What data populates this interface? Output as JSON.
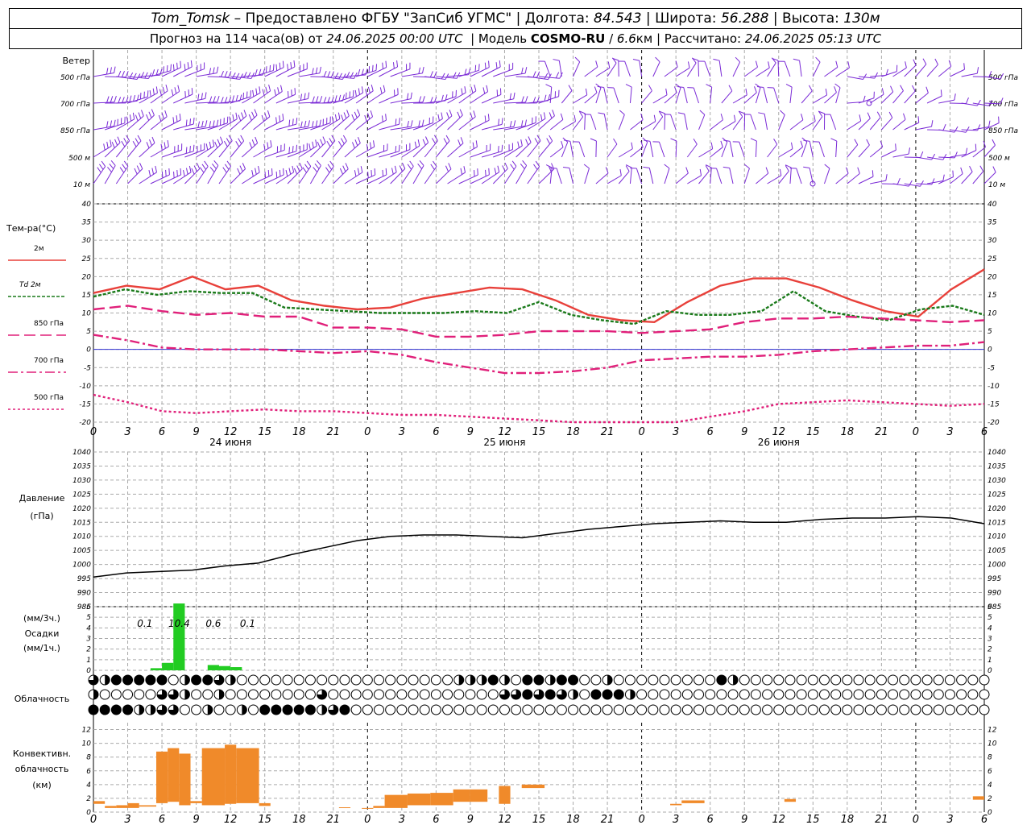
{
  "header": {
    "station": "Tom_Tomsk",
    "provider": " – Предоставлено ФГБУ \"ЗапСиб УГМС\" | Долгота: ",
    "lon": "84.543",
    "lat_label": " | Широта: ",
    "lat": "56.288",
    "alt_label": " | Высота: ",
    "alt": "130м",
    "forecast_prefix": "Прогноз на 114 часа(ов) от ",
    "forecast_date": "24.06.2025 00:00 UTC",
    "model_label": "  | Модель ",
    "model_name": "COSMO-RU",
    "model_res_prefix": " / ",
    "model_res": "6.6",
    "model_res_unit": "км",
    "calc_label": " | Рассчитано: ",
    "calc_date": "24.06.2025 05:13 UTC"
  },
  "chart_data": [
    {
      "type": "line",
      "id": "wind",
      "title": "Ветер",
      "levels": [
        "500 гПа",
        "700 гПа",
        "850 гПа",
        "500 м",
        "10 м"
      ],
      "colors": {
        "barbs": "#7a2ad6"
      }
    },
    {
      "type": "line",
      "id": "temperature",
      "ylabel": "Тем-ра(°C)",
      "ylim": [
        -20,
        40
      ],
      "yticks": [
        -20,
        -15,
        -10,
        -5,
        0,
        5,
        10,
        15,
        20,
        25,
        30,
        35,
        40
      ],
      "x_hours": [
        0,
        3,
        6,
        9,
        12,
        15,
        18,
        21,
        24,
        27,
        30,
        33,
        36,
        39,
        42,
        45,
        48,
        51,
        54,
        57,
        60,
        63,
        66,
        69,
        72,
        75,
        78
      ],
      "series": [
        {
          "name": "2м",
          "color": "#e8403a",
          "dash": "",
          "values": [
            15.5,
            17.5,
            16.5,
            20,
            16.5,
            17.5,
            13.5,
            12,
            11,
            11.5,
            14,
            15.5,
            17,
            16.5,
            13.5,
            9.5,
            8,
            7.5,
            13,
            17.5,
            19.5,
            19.5,
            17,
            13.5,
            10.5,
            9,
            16.5,
            22
          ]
        },
        {
          "name": "Td 2м",
          "color": "#1a7a1a",
          "dash": "4,2",
          "values": [
            14.5,
            16.5,
            15,
            16,
            15.5,
            15.5,
            11.5,
            11,
            10.5,
            10,
            10,
            10,
            10.5,
            10,
            13,
            9.5,
            8,
            7,
            10.5,
            9.5,
            9.5,
            10.5,
            16,
            10.5,
            9,
            8,
            11,
            12,
            9.5
          ]
        },
        {
          "name": "850 гПа",
          "color": "#e0207a",
          "dash": "14,6",
          "values": [
            11,
            12,
            10.5,
            9.5,
            10,
            9,
            9,
            6,
            6,
            5.5,
            3.5,
            3.5,
            4,
            5,
            5,
            5,
            4.5,
            5,
            5.5,
            7.5,
            8.5,
            8.5,
            9,
            8.5,
            8,
            7.5,
            8
          ]
        },
        {
          "name": "700 гПа",
          "color": "#e0207a",
          "dash": "12,4,3,4",
          "values": [
            4,
            2.5,
            0.5,
            0,
            0,
            0,
            -0.5,
            -1,
            -0.5,
            -1.5,
            -3.5,
            -5,
            -6.5,
            -6.5,
            -6,
            -5,
            -3,
            -2.5,
            -2,
            -2,
            -1.5,
            -0.5,
            0,
            0.5,
            1,
            1,
            2
          ]
        },
        {
          "name": "500 гПа",
          "color": "#e0207a",
          "dash": "3,3",
          "values": [
            -12.5,
            -14.5,
            -17,
            -17.5,
            -17,
            -16.5,
            -17,
            -17,
            -17.5,
            -18,
            -18,
            -18.5,
            -19,
            -19.5,
            -20,
            -20.5,
            -21,
            -20,
            -18.5,
            -17,
            -15,
            -14.5,
            -14,
            -14.5,
            -15,
            -15.5,
            -15
          ]
        }
      ],
      "zero_line_color": "#3030d0"
    },
    {
      "type": "line",
      "id": "pressure",
      "ylabel": "Давление",
      "yunit": "(гПа)",
      "ylim": [
        985,
        1040
      ],
      "yticks": [
        985,
        990,
        995,
        1000,
        1005,
        1010,
        1015,
        1020,
        1025,
        1030,
        1035,
        1040
      ],
      "values": [
        995.5,
        997,
        997.5,
        998,
        999.5,
        1000.5,
        1003.5,
        1006,
        1008.5,
        1010,
        1010.5,
        1010.5,
        1010,
        1009.5,
        1011,
        1012.5,
        1013.5,
        1014.5,
        1015,
        1015.5,
        1015,
        1015,
        1016,
        1016.5,
        1016.5,
        1017,
        1016.5,
        1014.5
      ],
      "color": "#000000"
    },
    {
      "type": "bar",
      "id": "precip",
      "ylabel": "Осадки",
      "unit_top": "(мм/3ч.)",
      "unit_bottom": "(мм/1ч.)",
      "ylim": [
        0,
        6
      ],
      "yticks": [
        0,
        1,
        2,
        3,
        4,
        5,
        6
      ],
      "sum_labels": [
        {
          "hour": 4.5,
          "text": "0.1"
        },
        {
          "hour": 7.5,
          "text": "10.4"
        },
        {
          "hour": 10.5,
          "text": "0.6"
        },
        {
          "hour": 13.5,
          "text": "0.1"
        }
      ],
      "bars_hourly": [
        {
          "h": 5,
          "v": 0.2
        },
        {
          "h": 6,
          "v": 0.7
        },
        {
          "h": 7,
          "v": 6.3
        },
        {
          "h": 10,
          "v": 0.5
        },
        {
          "h": 11,
          "v": 0.4
        },
        {
          "h": 12,
          "v": 0.3
        }
      ],
      "color": "#22cc22"
    },
    {
      "type": "table",
      "id": "clouds",
      "ylabel": "Облачность",
      "rows": [
        [
          0.75,
          0.5,
          1,
          1,
          1,
          1,
          1,
          0,
          0.5,
          1,
          1,
          0.75,
          0.5,
          0,
          0,
          0,
          0,
          0,
          0,
          0,
          0,
          0,
          0,
          0,
          0,
          0,
          0,
          0,
          0,
          0,
          0,
          0,
          0.5,
          0.5,
          0.5,
          1,
          0.5,
          0,
          1,
          1,
          0.5,
          1,
          1,
          0,
          0,
          0.5,
          0,
          0,
          0,
          0,
          0,
          0,
          0,
          0,
          0,
          1,
          0.5,
          0,
          0,
          0,
          0,
          0,
          0,
          0,
          0,
          0,
          0,
          0,
          0,
          0,
          0,
          0,
          0,
          0,
          0,
          0,
          0,
          0,
          0,
          0,
          0,
          0,
          0,
          0,
          0,
          0,
          0,
          0
        ],
        [
          0.5,
          0,
          0,
          0,
          0,
          0,
          0.75,
          0.75,
          0.5,
          0,
          0,
          0.5,
          0,
          0,
          0,
          0,
          0,
          0,
          0,
          0,
          0.75,
          0,
          0,
          0,
          0,
          0,
          0,
          0,
          0,
          0,
          0,
          0,
          0,
          0,
          0,
          0,
          0.75,
          0.75,
          1,
          0.75,
          1,
          0.75,
          0.5,
          0,
          1,
          1,
          1,
          0.5,
          0,
          0,
          0,
          0,
          0,
          0,
          0,
          0,
          0,
          0,
          0,
          0,
          0,
          0,
          0,
          0,
          0,
          0,
          0,
          0,
          0,
          0,
          0,
          0,
          0,
          0,
          0,
          0,
          0,
          0,
          0,
          0,
          0,
          0,
          0,
          0,
          0,
          0,
          0,
          0
        ],
        [
          1,
          1,
          1,
          1,
          0.5,
          0.5,
          0.75,
          0.75,
          0,
          0,
          0.5,
          0,
          0,
          0.5,
          0,
          1,
          1,
          1,
          1,
          1,
          0.5,
          0.75,
          1,
          0,
          0,
          0,
          0,
          0,
          0,
          0,
          0,
          0,
          0,
          0,
          0,
          0,
          0,
          0,
          0,
          0,
          0,
          0,
          0,
          0,
          0,
          0,
          0,
          0,
          0,
          0,
          0,
          0,
          0,
          0,
          0,
          0,
          0,
          0,
          0,
          0,
          0,
          0,
          0,
          0,
          0,
          0,
          0,
          0,
          0,
          0,
          0,
          0,
          0,
          0,
          0,
          0,
          0,
          0,
          0,
          0,
          0,
          0,
          0,
          0,
          0,
          0,
          0,
          0
        ]
      ]
    },
    {
      "type": "bar",
      "id": "convective",
      "ylabel": "Конвективн.",
      "ylabel2": "облачность",
      "yunit": "(км)",
      "ylim": [
        0,
        13
      ],
      "yticks": [
        0,
        2,
        4,
        6,
        8,
        10,
        12
      ],
      "bars": [
        {
          "h0": 0,
          "h1": 1,
          "base": 1.2,
          "top": 1.6
        },
        {
          "h0": 1,
          "h1": 2,
          "base": 0.6,
          "top": 0.9
        },
        {
          "h0": 2,
          "h1": 3,
          "base": 0.6,
          "top": 1.0
        },
        {
          "h0": 3,
          "h1": 4,
          "base": 0.6,
          "top": 1.3
        },
        {
          "h0": 4,
          "h1": 5.5,
          "base": 0.8,
          "top": 1.0
        },
        {
          "h0": 5.5,
          "h1": 6.5,
          "base": 1.3,
          "top": 8.8
        },
        {
          "h0": 6.5,
          "h1": 7.5,
          "base": 1.5,
          "top": 9.3
        },
        {
          "h0": 7.5,
          "h1": 8.5,
          "base": 1.0,
          "top": 8.5
        },
        {
          "h0": 8.5,
          "h1": 9.5,
          "base": 1.3,
          "top": 1.6
        },
        {
          "h0": 9.5,
          "h1": 11.5,
          "base": 1.0,
          "top": 9.3
        },
        {
          "h0": 11.5,
          "h1": 12.5,
          "base": 1.2,
          "top": 9.8
        },
        {
          "h0": 12.5,
          "h1": 14.5,
          "base": 1.3,
          "top": 9.3
        },
        {
          "h0": 14.5,
          "h1": 15.5,
          "base": 0.9,
          "top": 1.3
        },
        {
          "h0": 21.5,
          "h1": 22.5,
          "base": 0.6,
          "top": 0.7
        },
        {
          "h0": 23.5,
          "h1": 24.5,
          "base": 0.5,
          "top": 0.6
        },
        {
          "h0": 24.5,
          "h1": 25.5,
          "base": 0.6,
          "top": 0.9
        },
        {
          "h0": 25.5,
          "h1": 27.5,
          "base": 0.6,
          "top": 2.5
        },
        {
          "h0": 27.5,
          "h1": 29.5,
          "base": 1.0,
          "top": 2.7
        },
        {
          "h0": 29.5,
          "h1": 31.5,
          "base": 1.0,
          "top": 2.8
        },
        {
          "h0": 31.5,
          "h1": 33,
          "base": 1.5,
          "top": 3.3
        },
        {
          "h0": 33,
          "h1": 34.5,
          "base": 1.5,
          "top": 3.3
        },
        {
          "h0": 35.5,
          "h1": 36.5,
          "base": 1.2,
          "top": 3.8
        },
        {
          "h0": 37.5,
          "h1": 39.5,
          "base": 3.5,
          "top": 4.0
        },
        {
          "h0": 50.5,
          "h1": 51.5,
          "base": 1.0,
          "top": 1.2
        },
        {
          "h0": 51.5,
          "h1": 53.5,
          "base": 1.3,
          "top": 1.7
        },
        {
          "h0": 60.5,
          "h1": 61.5,
          "base": 1.5,
          "top": 1.9
        },
        {
          "h0": 77,
          "h1": 78,
          "base": 1.8,
          "top": 2.3
        }
      ],
      "color": "#f08a2a"
    }
  ],
  "time_axis": {
    "hour_labels": [
      "0",
      "3",
      "6",
      "9",
      "12",
      "15",
      "18",
      "21",
      "0",
      "3",
      "6",
      "9",
      "12",
      "15",
      "18",
      "21",
      "0",
      "3",
      "6",
      "9",
      "12",
      "15",
      "18",
      "21",
      "0",
      "3",
      "6"
    ],
    "day_labels": [
      "24 июня",
      "25 июня",
      "26 июня"
    ]
  }
}
